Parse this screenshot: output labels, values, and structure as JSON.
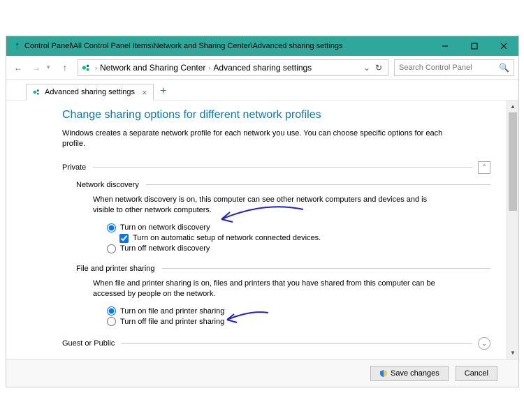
{
  "window": {
    "title": "Control Panel\\All Control Panel Items\\Network and Sharing Center\\Advanced sharing settings"
  },
  "breadcrumb": {
    "item1": "Network and Sharing Center",
    "item2": "Advanced sharing settings"
  },
  "search": {
    "placeholder": "Search Control Panel"
  },
  "tab": {
    "label": "Advanced sharing settings"
  },
  "page": {
    "title": "Change sharing options for different network profiles",
    "desc": "Windows creates a separate network profile for each network you use. You can choose specific options for each profile."
  },
  "private": {
    "label": "Private",
    "network_discovery": {
      "label": "Network discovery",
      "desc": "When network discovery is on, this computer can see other network computers and devices and is visible to other network computers.",
      "on": "Turn on network discovery",
      "auto": "Turn on automatic setup of network connected devices.",
      "off": "Turn off network discovery"
    },
    "file_printer": {
      "label": "File and printer sharing",
      "desc": "When file and printer sharing is on, files and printers that you have shared from this computer can be accessed by people on the network.",
      "on": "Turn on file and printer sharing",
      "off": "Turn off file and printer sharing"
    }
  },
  "guest": {
    "label": "Guest or Public"
  },
  "footer": {
    "save": "Save changes",
    "cancel": "Cancel"
  }
}
